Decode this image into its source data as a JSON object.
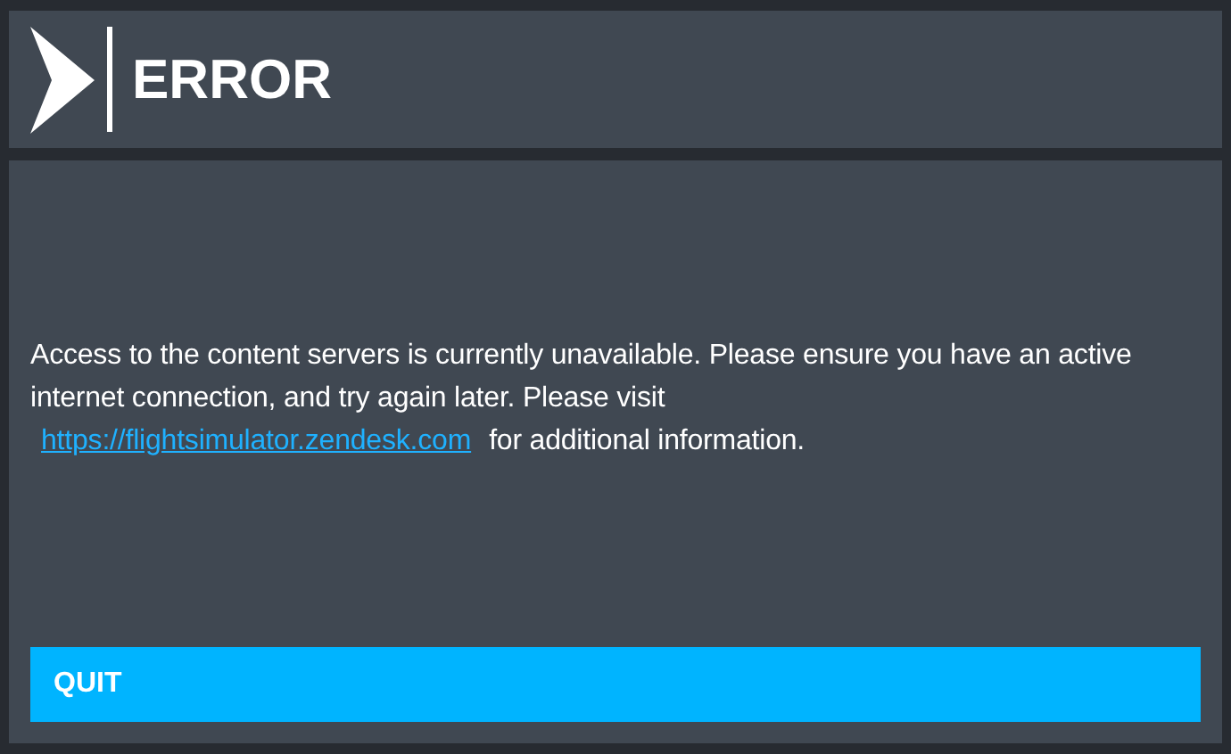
{
  "header": {
    "title": "ERROR"
  },
  "message": {
    "text_before": "Access to the content servers is currently unavailable. Please ensure you have an active internet connection, and try again later. Please visit",
    "link": "https://flightsimulator.zendesk.com",
    "text_after": "for additional information."
  },
  "buttons": [
    {
      "label": "QUIT"
    }
  ]
}
